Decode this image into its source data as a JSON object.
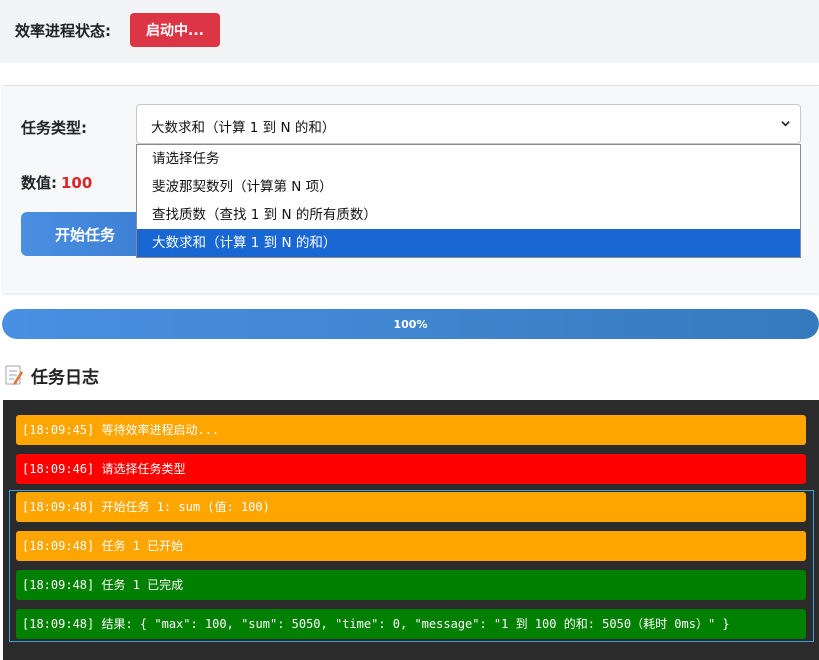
{
  "status": {
    "label": "效率进程状态:",
    "badge": "启动中...",
    "badge_color": "#dc3545"
  },
  "task": {
    "type_label": "任务类型:",
    "selected": "大数求和（计算 1 到 N 的和）",
    "options": [
      "请选择任务",
      "斐波那契数列（计算第 N 项）",
      "查找质数（查找 1 到 N 的所有质数）",
      "大数求和（计算 1 到 N 的和）"
    ],
    "value_label": "数值:",
    "value": "100",
    "start_button": "开始任务"
  },
  "progress": {
    "percent": 100,
    "text": "100%"
  },
  "log": {
    "title": "任务日志",
    "entries": [
      {
        "text": "[18:09:45] 等待效率进程启动...",
        "level": "orange"
      },
      {
        "text": "[18:09:46] 请选择任务类型",
        "level": "red"
      },
      {
        "text": "[18:09:48] 开始任务 1: sum (值: 100)",
        "level": "orange"
      },
      {
        "text": "[18:09:48] 任务 1 已开始",
        "level": "orange"
      },
      {
        "text": "[18:09:48] 任务 1 已完成",
        "level": "green"
      },
      {
        "text": "[18:09:48] 结果: { \"max\": 100, \"sum\": 5050, \"time\": 0, \"message\": \"1 到 100 的和: 5050（耗时 0ms）\" }",
        "level": "green"
      }
    ]
  },
  "colors": {
    "accent": "#4a8fe0",
    "danger": "#dc3545",
    "value_red": "#e02424",
    "log_orange": "#ffa500",
    "log_red": "#ff0000",
    "log_green": "#008000"
  }
}
